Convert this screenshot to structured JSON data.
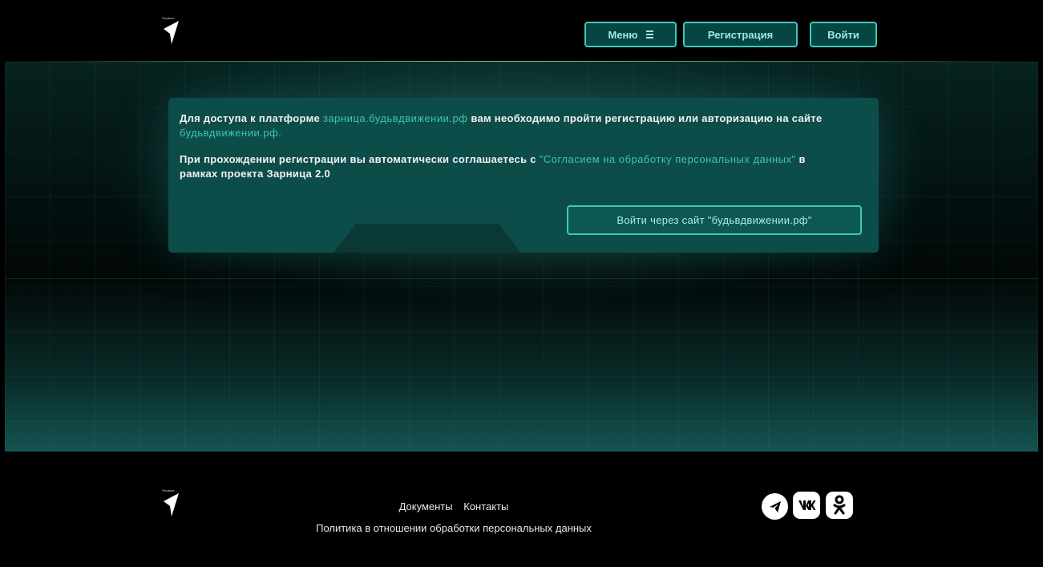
{
  "header": {
    "logo_caption": "Первые",
    "menu_label": "Меню",
    "register_label": "Регистрация",
    "login_label": "Войти"
  },
  "notice": {
    "p1_before": "Для доступа к платформе ",
    "p1_link1": "зарница.будьвдвижении.рф",
    "p1_middle": " вам необходимо пройти регистрацию или авторизацию на сайте ",
    "p1_link2": "будьвдвижении.рф.",
    "p2_before": "При прохождении регистрации вы автоматически соглашаетесь с ",
    "p2_link": "\"Согласием на обработку персональных данных\"",
    "p2_after": " в рамках проекта Зарница 2.0",
    "button_label": "Войти через сайт \"будьвдвижении.рф\""
  },
  "footer": {
    "logo_caption": "Первые",
    "documents_label": "Документы",
    "contacts_label": "Контакты",
    "privacy_label": "Политика в отношении обработки персональных данных",
    "social": [
      "telegram-icon",
      "vk-icon",
      "odnoklassniki-icon"
    ]
  },
  "colors": {
    "accent": "#3fc9bc",
    "card_bg": "#0d4d49",
    "highlight_text": "#3cc4b5"
  }
}
